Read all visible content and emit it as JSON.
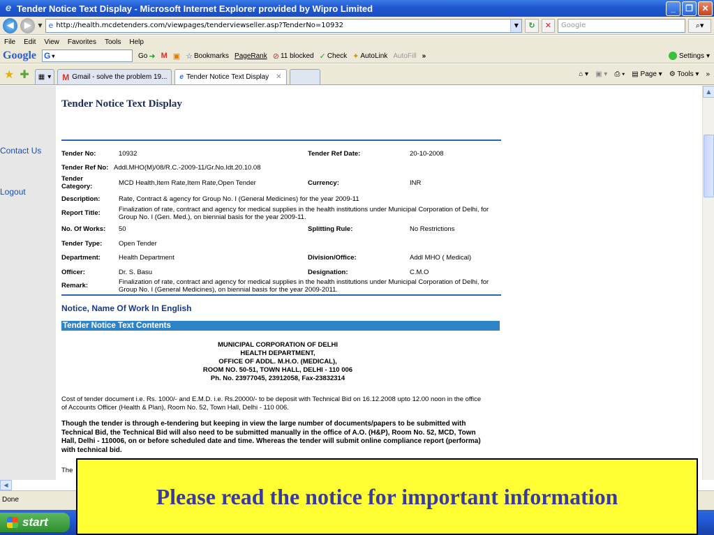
{
  "window": {
    "title": "Tender Notice Text Display - Microsoft Internet Explorer provided by Wipro Limited"
  },
  "address_bar": {
    "url": "http://health.mcdetenders.com/viewpages/tenderviewseller.asp?TenderNo=10932",
    "search_placeholder": "Google"
  },
  "menu": [
    "File",
    "Edit",
    "View",
    "Favorites",
    "Tools",
    "Help"
  ],
  "google_toolbar": {
    "logo": "Google",
    "search_value": "G",
    "go": "Go",
    "bookmarks": "Bookmarks",
    "pagerank": "PageRank",
    "blocked": "11 blocked",
    "check": "Check",
    "autolink": "AutoLink",
    "autofill": "AutoFill",
    "more": "»",
    "settings": "Settings"
  },
  "tabs": [
    {
      "label": "Gmail - solve the problem 19...",
      "active": false
    },
    {
      "label": "Tender Notice Text Display",
      "active": true
    }
  ],
  "command_bar": {
    "page": "Page",
    "tools": "Tools",
    "more": "»"
  },
  "left_nav": {
    "contact": "Contact Us",
    "logout": "Logout"
  },
  "page": {
    "title": "Tender Notice Text Display",
    "fields": {
      "tender_no_label": "Tender No:",
      "tender_no": "10932",
      "ref_date_label": "Tender Ref Date:",
      "ref_date": "20-10-2008",
      "ref_no_label": "Tender Ref No:",
      "ref_no": "Addl.MHO(M)/08/R.C.-2009-11/Gr.No.Idt.20.10.08",
      "category_label": "Tender Category:",
      "category": "MCD Health,Item Rate,Item Rate,Open Tender",
      "currency_label": "Currency:",
      "currency": "INR",
      "description_label": "Description:",
      "description": "Rate, Contract & agency for Group No. I (General Medicines) for the year 2009-11",
      "report_title_label": "Report Title:",
      "report_title": "Finalization of rate, contract and agency for medical supplies in the health institutions under Municipal Corporation of Delhi, for Group No. I (Gen. Med.), on biennial basis for the year 2009-11.",
      "works_label": "No. Of Works:",
      "works": "50",
      "splitting_label": "Splitting Rule:",
      "splitting": "No Restrictions",
      "type_label": "Tender Type:",
      "type": "Open Tender",
      "department_label": "Department:",
      "department": "Health Department",
      "division_label": "Division/Office:",
      "division": "Addl MHO ( Medical)",
      "officer_label": "Officer:",
      "officer": "Dr. S. Basu",
      "designation_label": "Designation:",
      "designation": "C.M.O",
      "remark_label": "Remark:",
      "remark": "Finalization of rate, contract and agency for medical supplies in the health institutions under Municipal Corporation of Delhi, for Group No. I (General Medicines), on biennial basis for the year 2009-2011."
    },
    "section_heading": "Notice, Name Of Work In English",
    "contents_heading": "Tender Notice Text Contents",
    "address_lines": [
      "MUNICIPAL CORPORATION OF DELHI",
      "HEALTH DEPARTMENT,",
      "OFFICE OF ADDL. M.H.O. (MEDICAL),",
      "ROOM NO. 50-51, TOWN HALL, DELHI - 110 006",
      "Ph. No. 23977045, 23912058, Fax-23832314"
    ],
    "para1": "Cost of tender document i.e. Rs. 1000/- and E.M.D. i.e. Rs.20000/- to be deposit with Technical Bid on 16.12.2008 upto 12.00 noon in the office of Accounts Officer (Health & Plan), Room No. 52, Town Hall, Delhi - 110 006.",
    "para2": "Though the tender is through e-tendering but keeping in view the large number of documents/papers to be submitted with Technical Bid, the Technical Bid will also need to be submitted manually in the office of A.O. (H&P), Room No. 52, MCD, Town Hall, Delhi - 110006, on or before scheduled date and time. Whereas the tender will submit online compliance report (performa) with technical bid.",
    "para3": "The"
  },
  "status": "Done",
  "taskbar": {
    "start": "start"
  },
  "banner": "Please read the notice for important information"
}
